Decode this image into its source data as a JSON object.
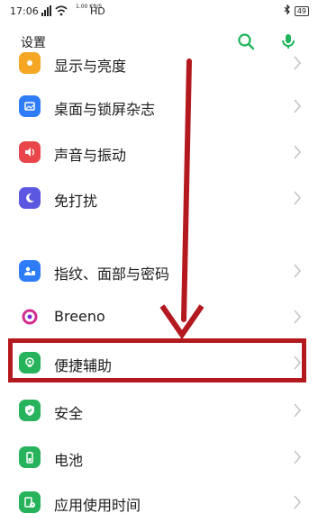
{
  "status_bar": {
    "time": "17:06",
    "signal_icons": "ıll ᯤ",
    "speed": "1.00 KB/S",
    "network": "HD",
    "battery": "49"
  },
  "header": {
    "title": "设置"
  },
  "colors": {
    "accent": "#1fb45a",
    "annotation_red": "#b3191e"
  },
  "settings": {
    "items": [
      {
        "label": "显示与亮度",
        "icon": "display-icon",
        "color": "#f5a623"
      },
      {
        "label": "桌面与锁屏杂志",
        "icon": "wallpaper-icon",
        "color": "#2e7cf6"
      },
      {
        "label": "声音与振动",
        "icon": "sound-icon",
        "color": "#e8464a"
      },
      {
        "label": "免打扰",
        "icon": "moon-icon",
        "color": "#5b57e0"
      },
      {
        "label": "指纹、面部与密码",
        "icon": "fingerprint-icon",
        "color": "#2e7cf6"
      },
      {
        "label": "Breeno",
        "icon": "breeno-icon",
        "color": "#d12d8f"
      },
      {
        "label": "便捷辅助",
        "icon": "assist-icon",
        "color": "#26b35b"
      },
      {
        "label": "安全",
        "icon": "shield-icon",
        "color": "#26b35b"
      },
      {
        "label": "电池",
        "icon": "battery-icon",
        "color": "#26b35b"
      },
      {
        "label": "应用使用时间",
        "icon": "hourglass-icon",
        "color": "#26b35b"
      }
    ]
  }
}
